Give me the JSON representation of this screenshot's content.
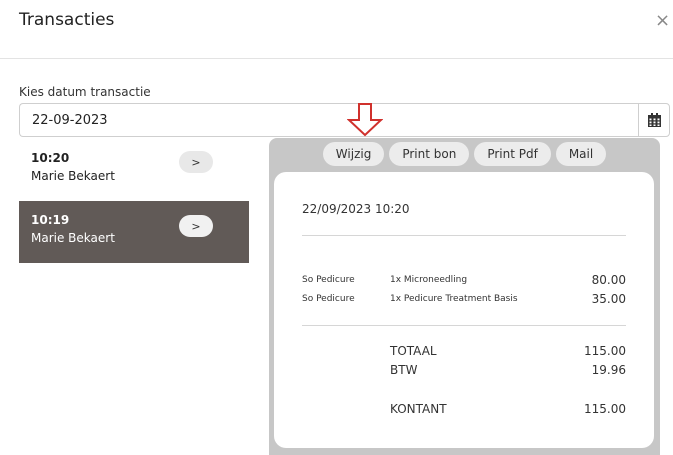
{
  "header": {
    "title": "Transacties",
    "close_label": "×"
  },
  "date": {
    "label": "Kies datum transactie",
    "value": "22-09-2023"
  },
  "transactions": [
    {
      "time": "10:20",
      "name": "Marie Bekaert",
      "button": ">",
      "active": false
    },
    {
      "time": "10:19",
      "name": "Marie Bekaert",
      "button": ">",
      "active": true
    }
  ],
  "actions": {
    "edit": "Wijzig",
    "print_receipt": "Print bon",
    "print_pdf": "Print Pdf",
    "mail": "Mail"
  },
  "receipt": {
    "datetime": "22/09/2023 10:20",
    "lines": [
      {
        "category": "So Pedicure",
        "description": "1x Microneedling",
        "amount": "80.00"
      },
      {
        "category": "So Pedicure",
        "description": "1x Pedicure Treatment Basis",
        "amount": "35.00"
      }
    ],
    "totals": {
      "total_label": "TOTAAL",
      "total_value": "115.00",
      "vat_label": "BTW",
      "vat_value": "19.96",
      "payment_label": "KONTANT",
      "payment_value": "115.00"
    }
  },
  "colors": {
    "active_item": "#615a57",
    "panel_bg": "#c7c7c7",
    "annotation_arrow": "#d0312d"
  }
}
